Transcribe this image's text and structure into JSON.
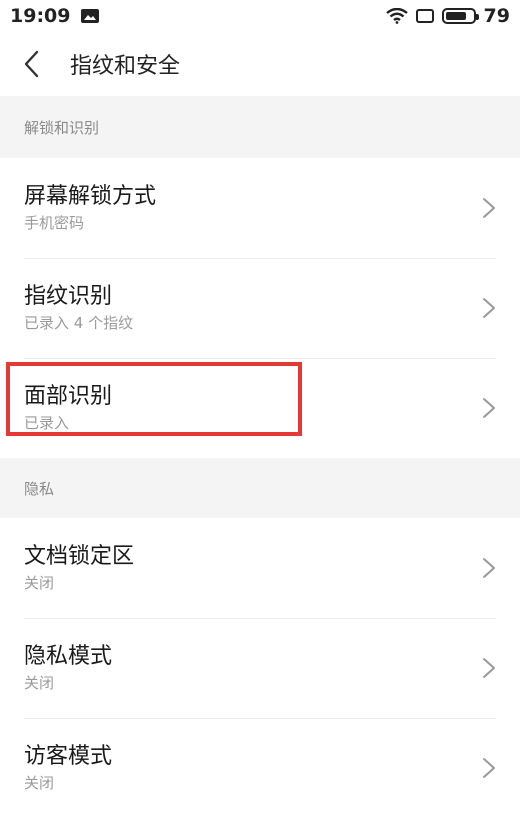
{
  "status_bar": {
    "time": "19:09",
    "battery_level": "79"
  },
  "nav": {
    "title": "指纹和安全"
  },
  "sections": [
    {
      "header": "解锁和识别",
      "rows": [
        {
          "title": "屏幕解锁方式",
          "subtitle": "手机密码"
        },
        {
          "title": "指纹识别",
          "subtitle": "已录入 4 个指纹"
        },
        {
          "title": "面部识别",
          "subtitle": "已录入"
        }
      ]
    },
    {
      "header": "隐私",
      "rows": [
        {
          "title": "文档锁定区",
          "subtitle": "关闭"
        },
        {
          "title": "隐私模式",
          "subtitle": "关闭"
        },
        {
          "title": "访客模式",
          "subtitle": "关闭"
        }
      ]
    }
  ],
  "highlight_color": "#e53935"
}
